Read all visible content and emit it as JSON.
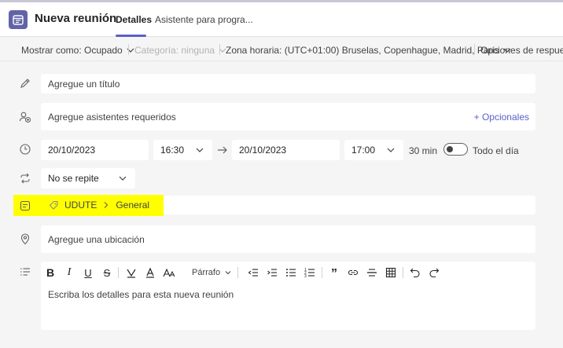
{
  "header": {
    "title": "Nueva reunión",
    "tabs": [
      {
        "label": "Detalles",
        "active": true
      },
      {
        "label": "Asistente para progra...",
        "active": false
      }
    ]
  },
  "options": {
    "show_as": "Mostrar como: Ocupado",
    "category": "Categoría: ninguna",
    "timezone": "Zona horaria: (UTC+01:00) Bruselas, Copenhague, Madrid, París",
    "response": "Opciones de respuesta"
  },
  "form": {
    "title_placeholder": "Agregue un título",
    "attendees_placeholder": "Agregue asistentes requeridos",
    "optional_label": "+ Opcionales",
    "start_date": "20/10/2023",
    "start_time": "16:30",
    "end_date": "20/10/2023",
    "end_time": "17:00",
    "duration": "30 min",
    "all_day_label": "Todo el día",
    "repeat": "No se repite",
    "channel_team": "UDUTE",
    "channel_name": "General",
    "location_placeholder": "Agregue una ubicación",
    "details_placeholder": "Escriba los detalles para esta nueva reunión",
    "paragraph_label": "Párrafo"
  },
  "colors": {
    "accent": "#5b5fc7",
    "highlight": "#ffff00"
  }
}
